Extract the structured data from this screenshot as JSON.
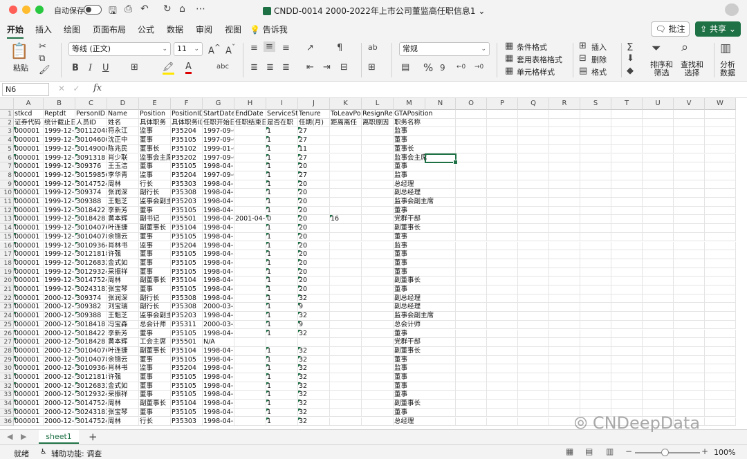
{
  "window": {
    "autosave_label": "自动保存",
    "title": "CNDD-0014 2000-2022年上市公司董监高任职信息1"
  },
  "menu": [
    "开始",
    "插入",
    "绘图",
    "页面布局",
    "公式",
    "数据",
    "审阅",
    "视图",
    "告诉我"
  ],
  "buttons": {
    "annotate": "批注",
    "share": "共享"
  },
  "ribbon": {
    "paste": "粘贴",
    "font_name": "等线 (正文)",
    "font_size": "11",
    "number_format": "常规",
    "conditional_format": "条件格式",
    "table_format": "套用表格格式",
    "cell_style": "单元格样式",
    "insert": "插入",
    "delete": "删除",
    "format": "格式",
    "sort_filter": [
      "排序和",
      "筛选"
    ],
    "find_select": [
      "查找和",
      "选择"
    ],
    "analyze": [
      "分析",
      "数据"
    ]
  },
  "formula_bar": {
    "name_box": "N6",
    "fx": "fx",
    "value": ""
  },
  "columns": [
    "A",
    "B",
    "C",
    "D",
    "E",
    "F",
    "G",
    "H",
    "I",
    "J",
    "K",
    "L",
    "M",
    "N",
    "O",
    "P",
    "Q",
    "R",
    "S",
    "T",
    "U",
    "V",
    "W"
  ],
  "rows": [
    [
      "stkcd",
      "Reptdt",
      "PersonID",
      "Name",
      "Position",
      "PositionID",
      "StartDate",
      "EndDate",
      "ServiceStatus",
      "Tenure",
      "ToLeavPosition",
      "ResignReason",
      "GTAPosition"
    ],
    [
      "证券代码",
      "统计截止日期",
      "人员ID",
      "姓名",
      "具体职务",
      "具体职务ID",
      "任职开始日期",
      "任职结束日期",
      "是否在职",
      "任期(月)",
      "距离离任",
      "离职原因",
      "职务名称"
    ],
    [
      "000001",
      "1999-12-31",
      "30112048",
      "符永江",
      "监事",
      "P35204",
      "1997-09-04",
      "",
      "1",
      "27",
      "",
      "",
      "监事"
    ],
    [
      "000001",
      "1999-12-31",
      "30104600",
      "沈正中",
      "董事",
      "P35105",
      "1997-09-04",
      "",
      "1",
      "27",
      "",
      "",
      "董事"
    ],
    [
      "000001",
      "1999-12-31",
      "30149006",
      "陈兆民",
      "董事长",
      "P35102",
      "1999-01-01",
      "",
      "1",
      "11",
      "",
      "",
      "董事长"
    ],
    [
      "000001",
      "1999-12-31",
      "3091318",
      "肖少联",
      "监事会主席",
      "P35202",
      "1997-09-04",
      "",
      "1",
      "27",
      "",
      "",
      "监事会主席"
    ],
    [
      "000001",
      "1999-12-31",
      "309376",
      "王玉洁",
      "董事",
      "P35105",
      "1998-04-17",
      "",
      "1",
      "20",
      "",
      "",
      "董事"
    ],
    [
      "000001",
      "1999-12-31",
      "30159856",
      "李华青",
      "监事",
      "P35204",
      "1997-09-04",
      "",
      "1",
      "27",
      "",
      "",
      "监事"
    ],
    [
      "000001",
      "1999-12-31",
      "30147524",
      "周林",
      "行长",
      "P35303",
      "1998-04-16",
      "",
      "1",
      "20",
      "",
      "",
      "总经理"
    ],
    [
      "000001",
      "1999-12-31",
      "309374",
      "张润深",
      "副行长",
      "P35308",
      "1998-04-16",
      "",
      "1",
      "20",
      "",
      "",
      "副总经理"
    ],
    [
      "000001",
      "1999-12-31",
      "309388",
      "王魁芝",
      "监事会副主席",
      "P35203",
      "1998-04-16",
      "",
      "1",
      "20",
      "",
      "",
      "监事会副主席"
    ],
    [
      "000001",
      "1999-12-31",
      "3018422",
      "李新芳",
      "董事",
      "P35105",
      "1998-04-16",
      "",
      "1",
      "20",
      "",
      "",
      "董事"
    ],
    [
      "000001",
      "1999-12-31",
      "3018428",
      "黄本辉",
      "副书记",
      "P35501",
      "1998-04-16",
      "2001-04-",
      "0",
      "20",
      "16",
      "",
      "党群干部"
    ],
    [
      "000001",
      "1999-12-31",
      "30104076",
      "叶连捷",
      "副董事长",
      "P35104",
      "1998-04-16",
      "",
      "1",
      "20",
      "",
      "",
      "副董事长"
    ],
    [
      "000001",
      "1999-12-31",
      "30104078",
      "余锦云",
      "董事",
      "P35105",
      "1998-04-16",
      "",
      "1",
      "20",
      "",
      "",
      "董事"
    ],
    [
      "000001",
      "1999-12-31",
      "30109364",
      "肖林书",
      "监事",
      "P35204",
      "1998-04-16",
      "",
      "1",
      "20",
      "",
      "",
      "监事"
    ],
    [
      "000001",
      "1999-12-31",
      "30121818",
      "许强",
      "董事",
      "P35105",
      "1998-04-16",
      "",
      "1",
      "20",
      "",
      "",
      "董事"
    ],
    [
      "000001",
      "1999-12-31",
      "30126832",
      "金式如",
      "董事",
      "P35105",
      "1998-04-16",
      "",
      "1",
      "20",
      "",
      "",
      "董事"
    ],
    [
      "000001",
      "1999-12-31",
      "30129324",
      "采振祥",
      "董事",
      "P35105",
      "1998-04-16",
      "",
      "1",
      "20",
      "",
      "",
      "董事"
    ],
    [
      "000001",
      "1999-12-31",
      "30147524",
      "周林",
      "副董事长",
      "P35104",
      "1998-04-16",
      "",
      "1",
      "20",
      "",
      "",
      "副董事长"
    ],
    [
      "000001",
      "1999-12-31",
      "30243183",
      "张宝琴",
      "董事",
      "P35105",
      "1998-04-16",
      "",
      "1",
      "20",
      "",
      "",
      "董事"
    ],
    [
      "000001",
      "2000-12-31",
      "309374",
      "张润深",
      "副行长",
      "P35308",
      "1998-04-16",
      "",
      "1",
      "32",
      "",
      "",
      "副总经理"
    ],
    [
      "000001",
      "2000-12-31",
      "309382",
      "刘宝瑞",
      "副行长",
      "P35308",
      "2000-03-24",
      "",
      "1",
      "9",
      "",
      "",
      "副总经理"
    ],
    [
      "000001",
      "2000-12-31",
      "309388",
      "王魁芝",
      "监事会副主席",
      "P35203",
      "1998-04-16",
      "",
      "1",
      "32",
      "",
      "",
      "监事会副主席"
    ],
    [
      "000001",
      "2000-12-31",
      "3018418",
      "冯宝森",
      "总会计师",
      "P35311",
      "2000-03-24",
      "",
      "1",
      "9",
      "",
      "",
      "总会计师"
    ],
    [
      "000001",
      "2000-12-31",
      "3018422",
      "李新芳",
      "董事",
      "P35105",
      "1998-04-16",
      "",
      "1",
      "32",
      "",
      "",
      "董事"
    ],
    [
      "000001",
      "2000-12-31",
      "3018428",
      "黄本辉",
      "工会主席",
      "P35501",
      "N/A",
      "",
      "",
      "",
      "",
      "",
      "党群干部"
    ],
    [
      "000001",
      "2000-12-31",
      "30104076",
      "叶连捷",
      "副董事长",
      "P35104",
      "1998-04-16",
      "",
      "1",
      "32",
      "",
      "",
      "副董事长"
    ],
    [
      "000001",
      "2000-12-31",
      "30104078",
      "余锦云",
      "董事",
      "P35105",
      "1998-04-16",
      "",
      "1",
      "32",
      "",
      "",
      "董事"
    ],
    [
      "000001",
      "2000-12-31",
      "30109364",
      "肖林书",
      "监事",
      "P35204",
      "1998-04-16",
      "",
      "1",
      "32",
      "",
      "",
      "监事"
    ],
    [
      "000001",
      "2000-12-31",
      "30121818",
      "许强",
      "董事",
      "P35105",
      "1998-04-16",
      "",
      "1",
      "32",
      "",
      "",
      "董事"
    ],
    [
      "000001",
      "2000-12-31",
      "30126832",
      "金式如",
      "董事",
      "P35105",
      "1998-04-16",
      "",
      "1",
      "32",
      "",
      "",
      "董事"
    ],
    [
      "000001",
      "2000-12-31",
      "30129324",
      "采振祥",
      "董事",
      "P35105",
      "1998-04-16",
      "",
      "1",
      "32",
      "",
      "",
      "董事"
    ],
    [
      "000001",
      "2000-12-31",
      "30147524",
      "周林",
      "副董事长",
      "P35104",
      "1998-04-16",
      "",
      "1",
      "32",
      "",
      "",
      "副董事长"
    ],
    [
      "000001",
      "2000-12-31",
      "30243183",
      "张宝琴",
      "董事",
      "P35105",
      "1998-04-16",
      "",
      "1",
      "32",
      "",
      "",
      "董事"
    ],
    [
      "000001",
      "2000-12-31",
      "30147524",
      "周林",
      "行长",
      "P35303",
      "1998-04-16",
      "",
      "1",
      "32",
      "",
      "",
      "总经理"
    ]
  ],
  "sheet_tab": "sheet1",
  "status": {
    "ready": "就绪",
    "accessibility": "辅助功能: 调查",
    "zoom": "100%"
  },
  "watermark": "CNDeepData"
}
